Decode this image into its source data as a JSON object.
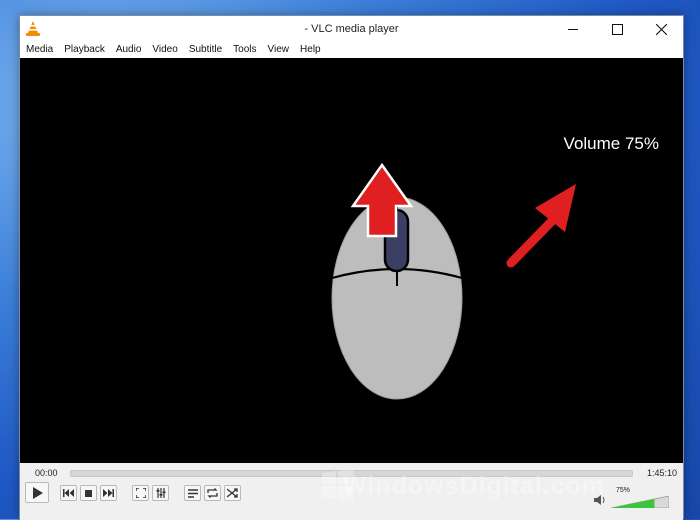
{
  "window": {
    "title": "- VLC media player",
    "minimize_icon": "minimize-icon",
    "maximize_icon": "maximize-icon",
    "close_icon": "close-icon"
  },
  "menu": [
    "Media",
    "Playback",
    "Audio",
    "Video",
    "Subtitle",
    "Tools",
    "View",
    "Help"
  ],
  "video": {
    "osd_text": "Volume 75%",
    "overlay_icons": [
      "mouse-illustration",
      "up-arrow-icon",
      "pointer-arrow-icon"
    ]
  },
  "controls": {
    "elapsed": "00:00",
    "total": "1:45:10",
    "seek_progress": 0,
    "volume_label": "75%",
    "volume_level": 0.75,
    "buttons": [
      "play-icon",
      "previous-icon",
      "stop-icon",
      "next-icon",
      "fullscreen-icon",
      "extended-settings-icon",
      "playlist-icon",
      "loop-icon",
      "shuffle-icon"
    ]
  },
  "watermark": {
    "text": "WindowsDigital.com"
  },
  "colors": {
    "accent_red": "#e02020",
    "volume_green": "#3cc43c",
    "vlc_orange": "#f48a00"
  }
}
